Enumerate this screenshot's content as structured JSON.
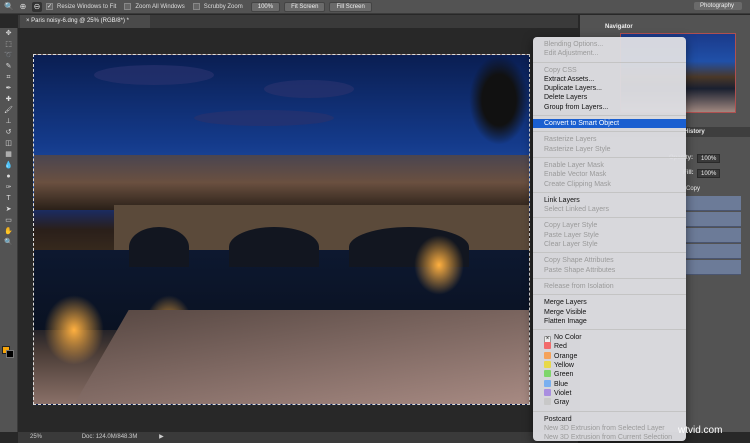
{
  "options_bar": {
    "resize_windows": "Resize Windows to Fit",
    "zoom_all": "Zoom All Windows",
    "scrubby": "Scrubby Zoom",
    "btn_100": "100%",
    "fit_screen": "Fit Screen",
    "fill_screen": "Fill Screen",
    "workspace": "Photography"
  },
  "document": {
    "tab_title": "Paris noisy-6.dng @ 25% (RGB/8*) *",
    "zoom": "25%",
    "doc_info": "Doc: 124.0M/848.3M"
  },
  "panels": {
    "navigator": "Navigator",
    "history": "History",
    "opacity_label": "Opacity:",
    "opacity": "100%",
    "fill_label": "Fill:",
    "fill": "100%",
    "layer_copy": "Copy"
  },
  "colors": {
    "foreground": "#f5a40a",
    "background": "#000000",
    "highlight": "#1a5fd0"
  },
  "context_menu": [
    [
      {
        "label": "Blending Options...",
        "enabled": false
      },
      {
        "label": "Edit Adjustment...",
        "enabled": false
      }
    ],
    [
      {
        "label": "Copy CSS",
        "enabled": false
      },
      {
        "label": "Extract Assets...",
        "enabled": true
      },
      {
        "label": "Duplicate Layers...",
        "enabled": true
      },
      {
        "label": "Delete Layers",
        "enabled": true
      },
      {
        "label": "Group from Layers...",
        "enabled": true
      }
    ],
    [
      {
        "label": "Convert to Smart Object",
        "enabled": true,
        "highlighted": true
      }
    ],
    [
      {
        "label": "Rasterize Layers",
        "enabled": false
      },
      {
        "label": "Rasterize Layer Style",
        "enabled": false
      }
    ],
    [
      {
        "label": "Enable Layer Mask",
        "enabled": false
      },
      {
        "label": "Enable Vector Mask",
        "enabled": false
      },
      {
        "label": "Create Clipping Mask",
        "enabled": false
      }
    ],
    [
      {
        "label": "Link Layers",
        "enabled": true
      },
      {
        "label": "Select Linked Layers",
        "enabled": false
      }
    ],
    [
      {
        "label": "Copy Layer Style",
        "enabled": false
      },
      {
        "label": "Paste Layer Style",
        "enabled": false
      },
      {
        "label": "Clear Layer Style",
        "enabled": false
      }
    ],
    [
      {
        "label": "Copy Shape Attributes",
        "enabled": false
      },
      {
        "label": "Paste Shape Attributes",
        "enabled": false
      }
    ],
    [
      {
        "label": "Release from Isolation",
        "enabled": false
      }
    ],
    [
      {
        "label": "Merge Layers",
        "enabled": true
      },
      {
        "label": "Merge Visible",
        "enabled": true
      },
      {
        "label": "Flatten Image",
        "enabled": true
      }
    ],
    [
      {
        "label": "No Color",
        "enabled": true,
        "swatch": "none"
      },
      {
        "label": "Red",
        "enabled": true,
        "swatch": "#f26b6b"
      },
      {
        "label": "Orange",
        "enabled": true,
        "swatch": "#f5a25a"
      },
      {
        "label": "Yellow",
        "enabled": true,
        "swatch": "#e8d94a"
      },
      {
        "label": "Green",
        "enabled": true,
        "swatch": "#7fd66a"
      },
      {
        "label": "Blue",
        "enabled": true,
        "swatch": "#7ab0f0"
      },
      {
        "label": "Violet",
        "enabled": true,
        "swatch": "#a98ee0"
      },
      {
        "label": "Gray",
        "enabled": true,
        "swatch": "#c8c8c8"
      }
    ],
    [
      {
        "label": "Postcard",
        "enabled": true
      },
      {
        "label": "New 3D Extrusion from Selected Layer",
        "enabled": false
      },
      {
        "label": "New 3D Extrusion from Current Selection",
        "enabled": false
      }
    ]
  ],
  "watermark": "wtvid.com"
}
